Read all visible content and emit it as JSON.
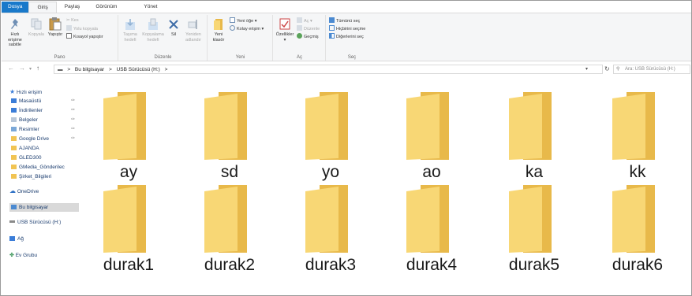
{
  "ribbon_tabs": [
    "Dosya",
    "Giriş",
    "Paylaş",
    "Görünüm",
    "Yönet"
  ],
  "clipboard": {
    "pin_label_1": "Hızlı erişime",
    "pin_label_2": "sabitle",
    "copy_label": "Kopyala",
    "paste_label": "Yapıştır",
    "cut_label": "Kes",
    "copy_path_label": "Yolu kopyala",
    "paste_shortcut_label": "Kısayol yapıştır",
    "group_label": "Pano"
  },
  "organize": {
    "move_label_1": "Taşıma",
    "move_label_2": "hedefi",
    "copyto_label_1": "Kopyalama",
    "copyto_label_2": "hedefi",
    "delete_label": "Sil",
    "rename_label_1": "Yeniden",
    "rename_label_2": "adlandır",
    "group_label": "Düzenle"
  },
  "new_group": {
    "new_folder_label_1": "Yeni",
    "new_folder_label_2": "klasör",
    "new_item_label": "Yeni öğe",
    "easy_access_label": "Kolay erişim",
    "group_label": "Yeni"
  },
  "open_group": {
    "properties_label": "Özellikler",
    "open_label": "Aç",
    "edit_label": "Düzenle",
    "history_label": "Geçmiş",
    "group_label": "Aç"
  },
  "select_group": {
    "select_all_label": "Tümünü seç",
    "select_none_label": "Hiçbirini seçme",
    "invert_label": "Diğerlerini seç",
    "group_label": "Seç"
  },
  "address": {
    "crumb_1": "Bu bilgisayar",
    "separator": ">",
    "crumb_2": "USB Sürücüsü (H:)",
    "search_placeholder": "Ara: USB Sürücüsü (H:)"
  },
  "nav_pane": {
    "quick_access": "Hızlı erişim",
    "desktop": "Masaüstü",
    "downloads": "İndirilenler",
    "documents": "Belgeler",
    "pictures": "Resimler",
    "google_drive": "Google Drive",
    "ajanda": "AJANDA",
    "gled300": "GLED300",
    "gmedia": "GMedia_Gönderilec",
    "sirket": "Şirket_Bilgileri",
    "onedrive": "OneDrive",
    "this_pc": "Bu bilgisayar",
    "usb_drive": "USB Sürücüsü (H:)",
    "network": "Ağ",
    "homegroup": "Ev Grubu"
  },
  "folders": [
    "ay",
    "sd",
    "yo",
    "ao",
    "ka",
    "kk",
    "durak1",
    "durak2",
    "durak3",
    "durak4",
    "durak5",
    "durak6"
  ],
  "colors": {
    "file_tab": "#1979ca",
    "folder_back": "#e8b94a",
    "folder_front": "#f8d775"
  }
}
